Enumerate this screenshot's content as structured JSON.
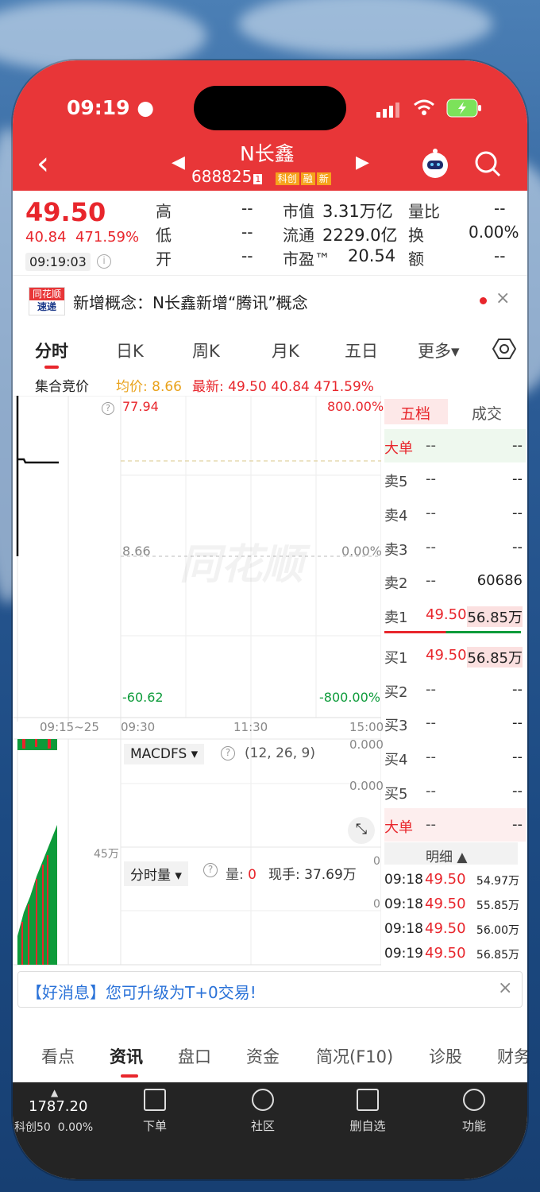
{
  "status": {
    "time": "09:19"
  },
  "header": {
    "stock_name": "N长鑫",
    "code": "688825",
    "badges": [
      "1",
      "科创",
      "融",
      "新"
    ]
  },
  "quote": {
    "price": "49.50",
    "change": "40.84",
    "change_pct": "471.59%",
    "timestamp": "09:19:03",
    "stats": [
      {
        "l1": "高",
        "v1": "--",
        "l2": "市值",
        "v2": "3.31万亿",
        "l3": "量比",
        "v3": "--"
      },
      {
        "l1": "低",
        "v1": "--",
        "l2": "流通",
        "v2": "2229.0亿",
        "l3": "换",
        "v3": "0.00%"
      },
      {
        "l1": "开",
        "v1": "--",
        "l2": "市盈™",
        "v2": "20.54",
        "l3": "额",
        "v3": "--"
      }
    ]
  },
  "news": {
    "source_line1": "同花顺",
    "source_line2": "速递",
    "text": "新增概念：N长鑫新增“腾讯”概念"
  },
  "tabs": [
    "分时",
    "日K",
    "周K",
    "月K",
    "五日",
    "更多▾"
  ],
  "infobar": {
    "label": "集合竞价",
    "avg": "均价: 8.66",
    "latest": "最新: 49.50 40.84 471.59%"
  },
  "chart": {
    "high_price": "77.94",
    "high_pct": "800.00%",
    "mid_price": "8.66",
    "mid_pct": "0.00%",
    "low_price": "-60.62",
    "low_pct": "-800.00%",
    "auction_axis": "09:15~25",
    "times": [
      "09:30",
      "11:30",
      "15:00"
    ],
    "macd_label": "MACDFS ▾",
    "macd_params": "(12, 26, 9)",
    "macd_top": "0.000",
    "macd_mid": "0.000",
    "vol_scale": "45万",
    "vol_label": "分时量 ▾",
    "vol_text": "量:",
    "vol_value": "0",
    "hand_text": "现手: 37.69万",
    "vol_zero_a": "0",
    "vol_zero_b": "0",
    "watermark": "同花顺"
  },
  "orderbook": {
    "tab_active": "五档",
    "tab_other": "成交",
    "rows": [
      {
        "label": "大单",
        "price": "--",
        "vol": "--"
      },
      {
        "label": "卖5",
        "price": "--",
        "vol": "--"
      },
      {
        "label": "卖4",
        "price": "--",
        "vol": "--"
      },
      {
        "label": "卖3",
        "price": "--",
        "vol": "--"
      },
      {
        "label": "卖2",
        "price": "--",
        "vol": "60686"
      },
      {
        "label": "卖1",
        "price": "49.50",
        "vol": "56.85万"
      },
      {
        "label": "买1",
        "price": "49.50",
        "vol": "56.85万"
      },
      {
        "label": "买2",
        "price": "--",
        "vol": "--"
      },
      {
        "label": "买3",
        "price": "--",
        "vol": "--"
      },
      {
        "label": "买4",
        "price": "--",
        "vol": "--"
      },
      {
        "label": "买5",
        "price": "--",
        "vol": "--"
      },
      {
        "label": "大单",
        "price": "--",
        "vol": "--"
      }
    ],
    "detail_label": "明细 ▲",
    "trades": [
      {
        "time": "09:18",
        "price": "49.50",
        "vol": "54.97万"
      },
      {
        "time": "09:18",
        "price": "49.50",
        "vol": "55.85万"
      },
      {
        "time": "09:18",
        "price": "49.50",
        "vol": "56.00万"
      },
      {
        "time": "09:19",
        "price": "49.50",
        "vol": "56.85万"
      }
    ]
  },
  "banner": {
    "text": "【好消息】您可升级为T+0交易!"
  },
  "footer_tabs": [
    "看点",
    "资讯",
    "盘口",
    "资金",
    "简况(F10)",
    "诊股",
    "财务"
  ],
  "bottom": {
    "index_value": "1787.20",
    "index_name": "科创50",
    "index_pct": "0.00%",
    "items": [
      "下单",
      "社区",
      "删自选",
      "功能"
    ]
  },
  "colors": {
    "red": "#e83638",
    "green": "#0d9b3a"
  }
}
